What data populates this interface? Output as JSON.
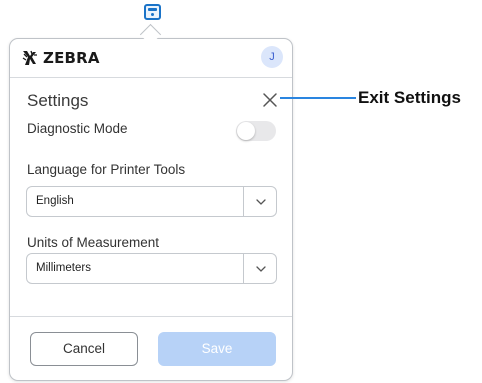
{
  "header": {
    "brand": "ZEBRA",
    "avatar_initial": "J"
  },
  "settings": {
    "title": "Settings",
    "diagnostic_mode_label": "Diagnostic Mode",
    "diagnostic_mode_on": false,
    "language_label": "Language for Printer Tools",
    "language_value": "English",
    "units_label": "Units of Measurement",
    "units_value": "Millimeters"
  },
  "footer": {
    "cancel_label": "Cancel",
    "save_label": "Save"
  },
  "annotation": {
    "text": "Exit Settings"
  },
  "colors": {
    "accent": "#2a85e0",
    "save_disabled": "#b7d2f7",
    "avatar_bg": "#dbe6fb"
  }
}
